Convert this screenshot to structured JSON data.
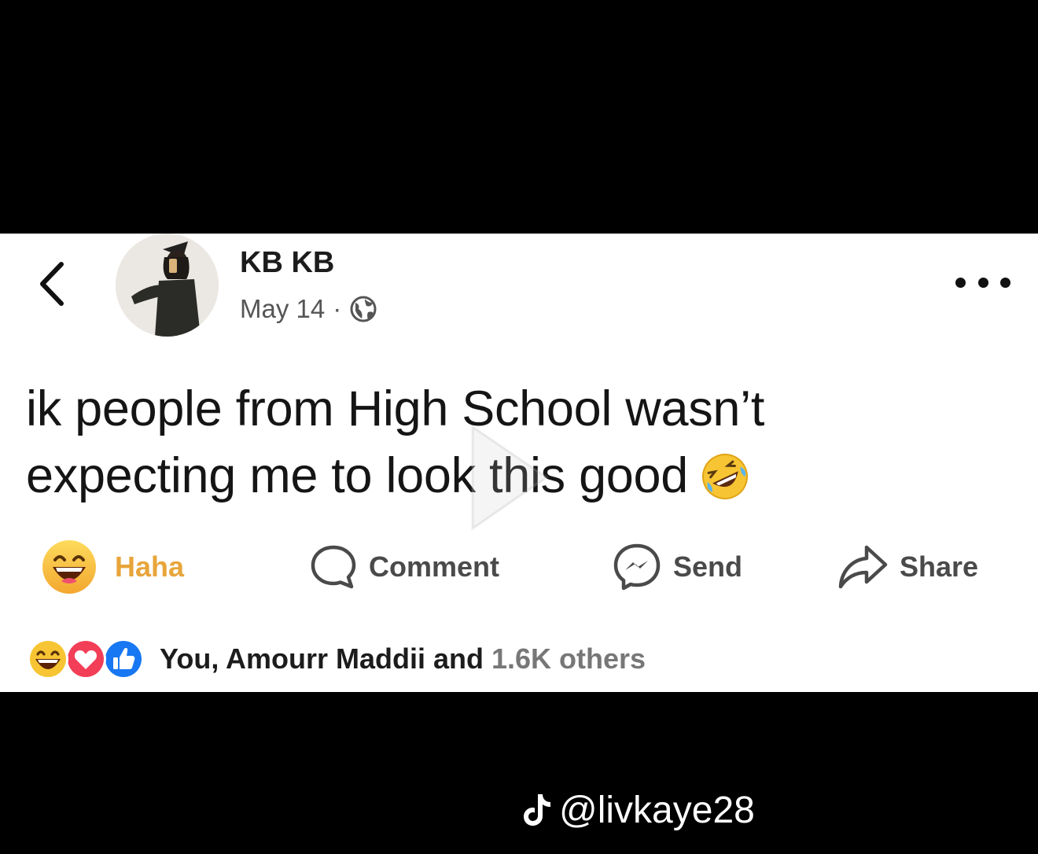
{
  "post": {
    "author": "KB KB",
    "date": "May 14",
    "separator": "·",
    "privacy_icon": "globe-icon",
    "text_line1": "ik people from High School wasn’t",
    "text_line2": "expecting me to look this good",
    "text_emoji": "rolling-on-floor-laughing-emoji"
  },
  "actions": {
    "reaction_label": "Haha",
    "comment_label": "Comment",
    "send_label": "Send",
    "share_label": "Share"
  },
  "reactions": {
    "icons": [
      "haha-icon",
      "love-icon",
      "like-icon"
    ],
    "text": "You, Amourr Maddii and",
    "count_text": "1.6K others"
  },
  "watermark": {
    "icon": "tiktok-icon",
    "handle": "@livkaye28"
  },
  "colors": {
    "haha_label": "#e8a53a",
    "love": "#f33e58",
    "like": "#1877f2",
    "text": "#151515",
    "action_text": "#4a4a4a"
  }
}
